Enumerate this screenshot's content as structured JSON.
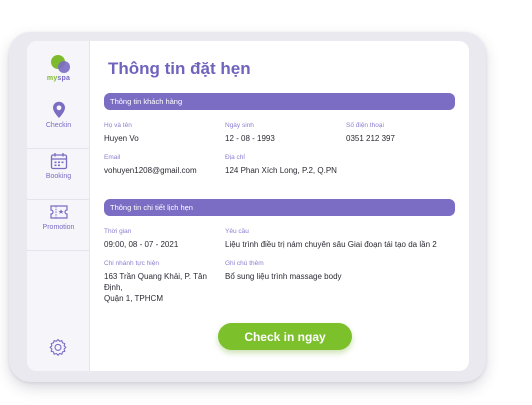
{
  "app": {
    "logo_text_primary": "my",
    "logo_text_secondary": "spa"
  },
  "sidebar": {
    "items": [
      {
        "label": "Checkin",
        "icon": "location-pin-icon"
      },
      {
        "label": "Booking",
        "icon": "calendar-icon"
      },
      {
        "label": "Promotion",
        "icon": "ticket-icon"
      }
    ],
    "settings_icon": "gear-icon"
  },
  "page": {
    "title": "Thông tin đặt hẹn"
  },
  "customer_section": {
    "heading": "Thông tin khách hàng",
    "name_label": "Họ và tên",
    "name_value": "Huyen Vo",
    "dob_label": "Ngày sinh",
    "dob_value": "12 - 08 - 1993",
    "phone_label": "Số điện thoại",
    "phone_value": "0351 212 397",
    "email_label": "Email",
    "email_value": "vohuyen1208@gmail.com",
    "address_label": "Địa chỉ",
    "address_value": "124 Phan Xích Long, P.2, Q.PN"
  },
  "booking_section": {
    "heading": "Thông tin chi tiết lịch hẹn",
    "time_label": "Thời gian",
    "time_value": "09:00, 08 - 07 - 2021",
    "request_label": "Yêu cầu",
    "request_value": "Liệu trình điều trị nám chuyên sâu Giai đoạn tái tạo da lần 2",
    "branch_label": "Chi nhánh tực hiện",
    "branch_value_line1": "163 Trần Quang Khải, P. Tân Định,",
    "branch_value_line2": "Quận 1, TPHCM",
    "note_label": "Ghi chú thêm",
    "note_value": "Bổ sung liệu trình massage body"
  },
  "actions": {
    "checkin_label": "Check in ngay"
  },
  "colors": {
    "accent_purple": "#7b6cc4",
    "accent_green": "#7cc02c"
  }
}
